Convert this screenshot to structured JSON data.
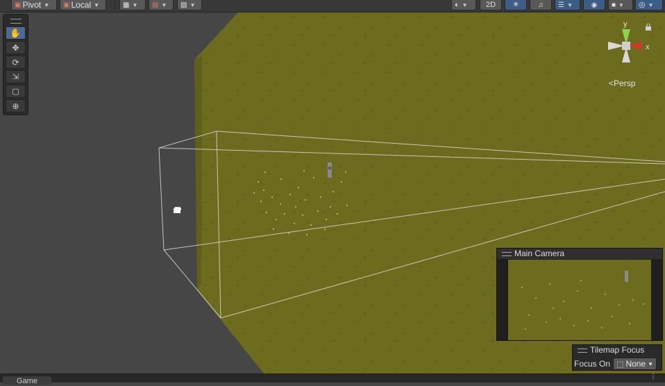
{
  "toolbar": {
    "pivot_label": "Pivot",
    "local_label": "Local",
    "mode_2d_label": "2D"
  },
  "gizmo": {
    "y_label": "y",
    "x_label": "x",
    "projection_label": "Persp"
  },
  "camera_preview": {
    "title": "Main Camera"
  },
  "tilemap_focus": {
    "title": "Tilemap Focus",
    "focus_label": "Focus On",
    "focus_value": "None"
  },
  "bottom_tab": {
    "label": "Game"
  },
  "colors": {
    "ground": "#6c6b1e",
    "background": "#464646",
    "accent_blue": "#3c5d86"
  }
}
